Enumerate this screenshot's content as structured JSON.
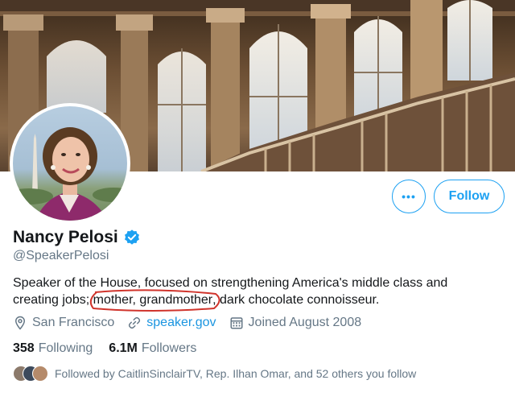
{
  "profile": {
    "name": "Nancy Pelosi",
    "handle": "@SpeakerPelosi",
    "bio_before": "Speaker of the House, focused on strengthening America's middle class and creating jobs; ",
    "bio_highlight": "mother, grandmother",
    "bio_after": ", dark chocolate connoisseur.",
    "location": "San Francisco",
    "website": "speaker.gov",
    "joined": "Joined August 2008"
  },
  "stats": {
    "following_count": "358",
    "following_label": "Following",
    "followers_count": "6.1M",
    "followers_label": "Followers"
  },
  "actions": {
    "more_label": "•••",
    "follow_label": "Follow"
  },
  "followed_by": "Followed by CaitlinSinclairTV, Rep. Ilhan Omar, and 52 others you follow",
  "icons": {
    "verified": "verified-badge-icon",
    "location": "location-pin-icon",
    "link": "link-icon",
    "calendar": "calendar-icon"
  },
  "colors": {
    "accent": "#1da1f2",
    "link": "#1b95e0",
    "secondary_text": "#657786",
    "annotation": "#d0342c"
  }
}
